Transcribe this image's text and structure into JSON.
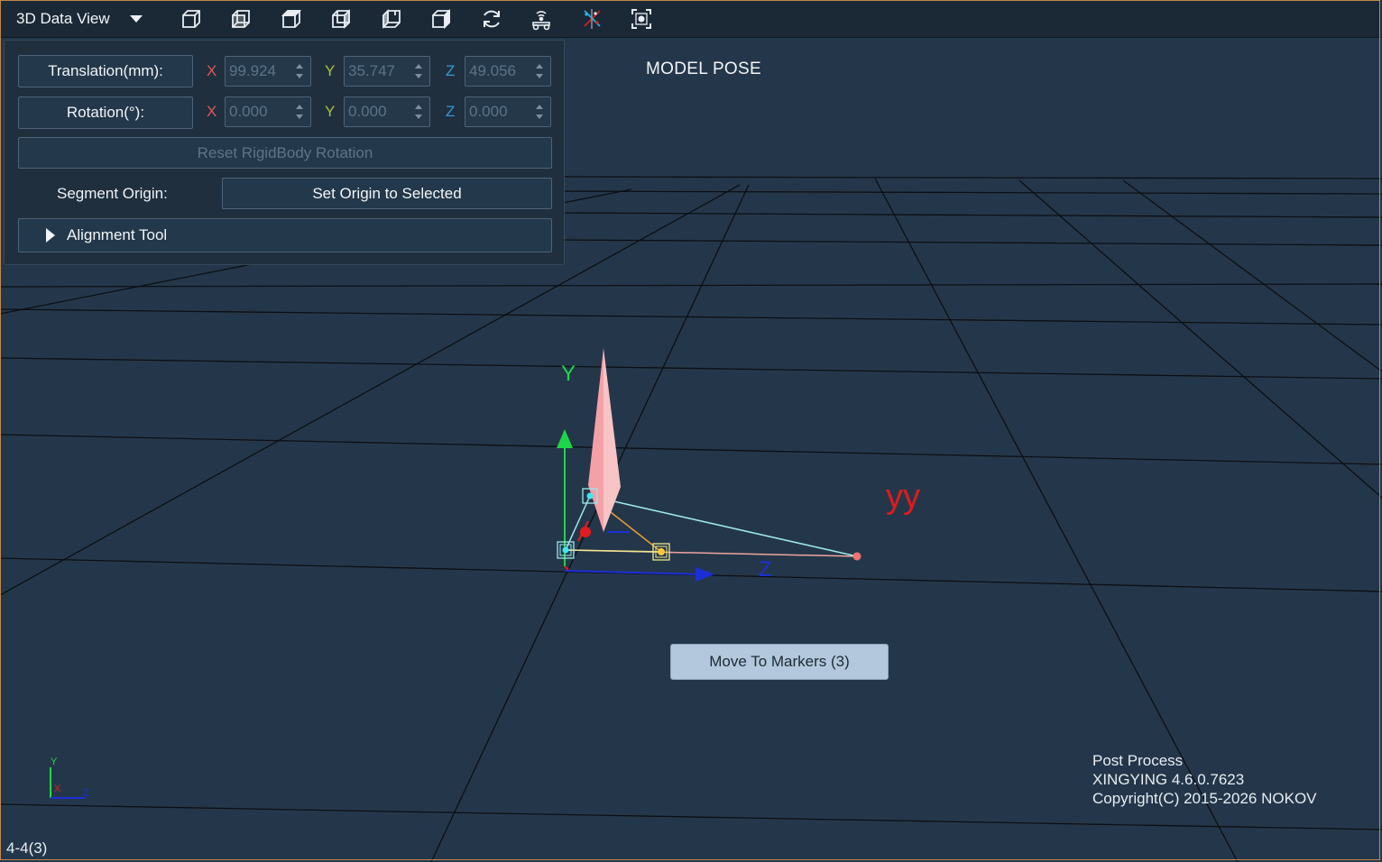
{
  "toolbar": {
    "view_selector": "3D Data View",
    "icons": [
      "cube-iso-icon",
      "cube-front-icon",
      "cube-top-icon",
      "cube-right-icon",
      "cube-left-icon",
      "cube-back-icon",
      "refresh-icon",
      "tracking-icon",
      "axis-scatter-icon",
      "focus-selection-icon"
    ]
  },
  "panel": {
    "translation_label": "Translation(mm):",
    "rotation_label": "Rotation(°):",
    "axis_x": "X",
    "axis_y": "Y",
    "axis_z": "Z",
    "translation": {
      "x": "99.924",
      "y": "35.747",
      "z": "49.056"
    },
    "rotation": {
      "x": "0.000",
      "y": "0.000",
      "z": "0.000"
    },
    "reset_label": "Reset RigidBody Rotation",
    "segment_origin_label": "Segment Origin:",
    "set_origin_label": "Set Origin to Selected",
    "alignment_tool_label": "Alignment Tool"
  },
  "scene": {
    "mode_title": "MODEL POSE",
    "axis_y_label": "Y",
    "axis_z_label": "Z",
    "segment_label": "yy",
    "move_to_markers_label": "Move To Markers (3)",
    "mini_axis": {
      "y": "Y",
      "x": "X",
      "z": "Z"
    }
  },
  "info": {
    "line1": "Post Process",
    "line2": "XINGYING 4.6.0.7623",
    "line3": "Copyright(C) 2015-2026 NOKOV"
  },
  "status": "4-4(3)",
  "colors": {
    "background": "#24374a",
    "toolbar": "#1b2937",
    "grid": "#000000",
    "axis_x": "#e0575b",
    "axis_y": "#a9c23a",
    "axis_z": "#3399d6",
    "segment_label": "#e11a1a",
    "bone": "#f7b2b7"
  }
}
